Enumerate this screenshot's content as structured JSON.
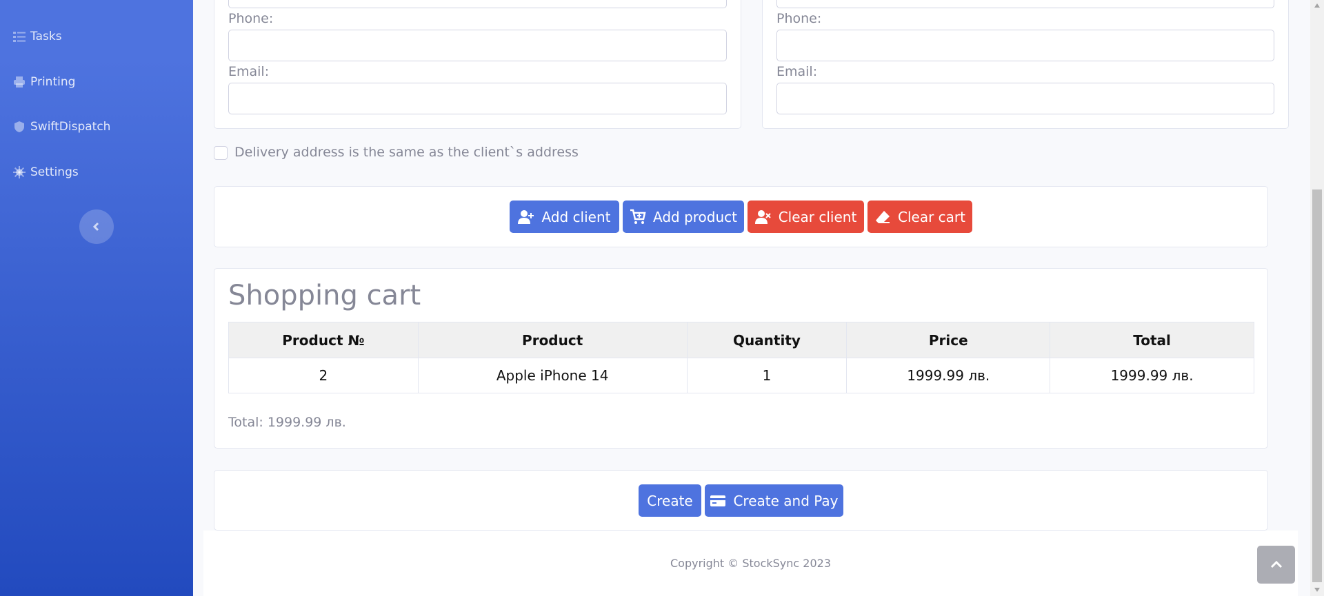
{
  "sidebar": {
    "items": [
      {
        "label": "Tasks",
        "icon": "tasks-icon"
      },
      {
        "label": "Printing",
        "icon": "printer-icon"
      },
      {
        "label": "SwiftDispatch",
        "icon": "shield-icon"
      },
      {
        "label": "Settings",
        "icon": "gear-icon"
      }
    ],
    "toggle_icon": "chevron-left-icon"
  },
  "client_form": {
    "phone_label": "Phone:",
    "email_label": "Email:"
  },
  "delivery_form": {
    "phone_label": "Phone:",
    "email_label": "Email:"
  },
  "delivery_checkbox_label": "Delivery address is the same as the client`s address",
  "actions": {
    "add_client": "Add client",
    "add_product": "Add product",
    "clear_client": "Clear client",
    "clear_cart": "Clear cart"
  },
  "cart": {
    "title": "Shopping cart",
    "columns": [
      "Product №",
      "Product",
      "Quantity",
      "Price",
      "Total"
    ],
    "rows": [
      [
        "2",
        "Apple iPhone 14",
        "1",
        "1999.99 лв.",
        "1999.99 лв."
      ]
    ],
    "total": "Total: 1999.99 лв."
  },
  "submit": {
    "create": "Create",
    "create_and_pay": "Create and Pay"
  },
  "footer": {
    "copyright": "Copyright © StockSync 2023"
  },
  "colors": {
    "primary": "#4e73df",
    "danger": "#e74a3b"
  }
}
